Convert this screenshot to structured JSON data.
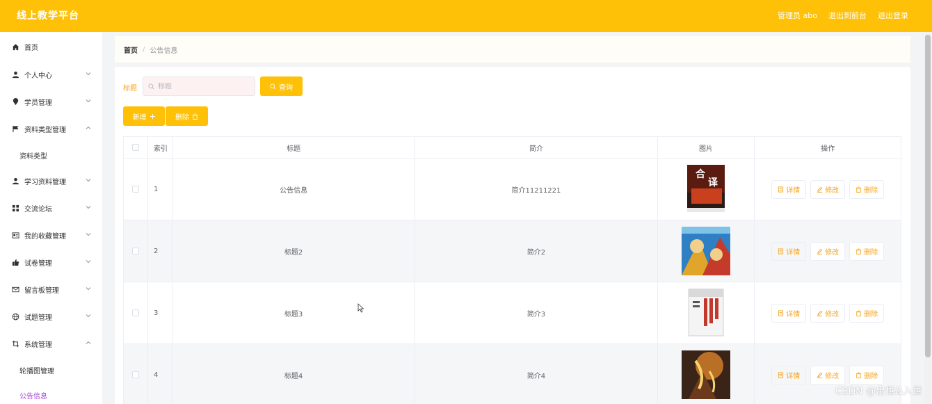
{
  "app": {
    "title": "线上教学平台",
    "accent_color": "#ffc107",
    "header_links": [
      "管理员 abo",
      "退出到前台",
      "退出登录"
    ]
  },
  "sidebar": {
    "items": [
      {
        "label": "首页",
        "icon": "home-icon",
        "chevron": ""
      },
      {
        "label": "个人中心",
        "icon": "user-icon",
        "chevron": "down"
      },
      {
        "label": "学员管理",
        "icon": "map-pin-icon",
        "chevron": "down"
      },
      {
        "label": "资料类型管理",
        "icon": "flag-icon",
        "chevron": "up"
      },
      {
        "label": "学习资料管理",
        "icon": "user-icon",
        "chevron": "down"
      },
      {
        "label": "交流论坛",
        "icon": "grid-icon",
        "chevron": "down"
      },
      {
        "label": "我的收藏管理",
        "icon": "id-card-icon",
        "chevron": "down"
      },
      {
        "label": "试卷管理",
        "icon": "thumbs-up-icon",
        "chevron": "down"
      },
      {
        "label": "留言板管理",
        "icon": "mail-icon",
        "chevron": "down"
      },
      {
        "label": "试题管理",
        "icon": "globe-icon",
        "chevron": "down"
      },
      {
        "label": "系统管理",
        "icon": "crop-icon",
        "chevron": "up"
      }
    ],
    "submenus": {
      "资料类型管理": [
        "资料类型"
      ],
      "系统管理": [
        "轮播图管理",
        "公告信息"
      ]
    },
    "active": "公告信息"
  },
  "breadcrumb": {
    "home": "首页",
    "separator": "/",
    "current": "公告信息"
  },
  "search": {
    "label": "标题",
    "placeholder": "标题",
    "value": "",
    "button": "查询"
  },
  "actions": {
    "add": "新增",
    "delete": "删除"
  },
  "table": {
    "columns": [
      "索引",
      "标题",
      "简介",
      "图片",
      "操作"
    ],
    "rows": [
      {
        "index": "1",
        "title": "公告信息",
        "intro": "简介11211221",
        "image": "book-cover-red-icon"
      },
      {
        "index": "2",
        "title": "标题2",
        "intro": "简介2",
        "image": "anime-poster-icon"
      },
      {
        "index": "3",
        "title": "标题3",
        "intro": "简介3",
        "image": "book-cover-white-icon"
      },
      {
        "index": "4",
        "title": "标题4",
        "intro": "简介4",
        "image": "fantasy-poster-icon"
      }
    ],
    "ops": {
      "detail": "详情",
      "edit": "修改",
      "remove": "删除"
    }
  },
  "watermark": "CSDN @出世&入世"
}
